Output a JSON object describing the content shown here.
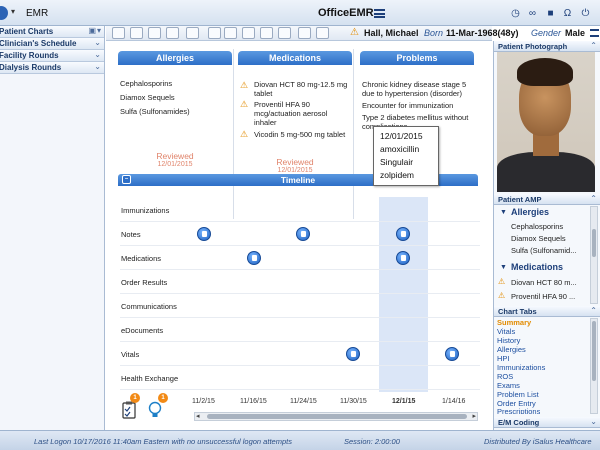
{
  "topbar": {
    "app_name": "EMR",
    "product_title": "OfficeEMR"
  },
  "sidebar": {
    "items": [
      {
        "label": "Patient Charts"
      },
      {
        "label": "Clinician's Schedule"
      },
      {
        "label": "Facility Rounds"
      },
      {
        "label": "Dialysis Rounds"
      }
    ]
  },
  "patient": {
    "name": "Hall, Michael",
    "born_label": "Born",
    "dob": "11-Mar-1968(48y)",
    "gender_label": "Gender",
    "gender": "Male"
  },
  "allergies": {
    "title": "Allergies",
    "items": [
      "Cephalosporins",
      "Diamox Sequels",
      "Sulfa (Sulfonamides)"
    ],
    "reviewed": "Reviewed",
    "reviewed_date": "12/01/2015"
  },
  "medications": {
    "title": "Medications",
    "items": [
      "Diovan HCT 80 mg-12.5 mg tablet",
      "Proventil HFA 90 mcg/actuation aerosol inhaler",
      "Vicodin 5 mg-500 mg tablet"
    ],
    "reviewed": "Reviewed",
    "reviewed_date": "12/01/2015"
  },
  "problems": {
    "title": "Problems",
    "items": [
      "Chronic kidney disease stage 5 due to hypertension (disorder)",
      "Encounter for immunization",
      "Type 2 diabetes mellitus without complications"
    ]
  },
  "popup": {
    "lines": [
      "12/01/2015",
      "amoxicillin",
      "Singulair",
      "zolpidem"
    ]
  },
  "timeline": {
    "title": "Timeline",
    "rows": [
      "Immunizations",
      "Notes",
      "Medications",
      "Order Results",
      "Communications",
      "eDocuments",
      "Vitals",
      "Health Exchange"
    ],
    "dates": [
      "11/2/15",
      "11/16/15",
      "11/24/15",
      "11/30/15",
      "12/1/15",
      "1/14/16"
    ],
    "badge_tasks": "1",
    "badge_alerts": "1"
  },
  "rightpanel": {
    "photo_header": "Patient Photograph",
    "amp_header": "Patient AMP",
    "allergies_title": "Allergies",
    "allergy_items": [
      "Cephalosporins",
      "Diamox Sequels",
      "Sulfa (Sulfonamid..."
    ],
    "medications_title": "Medications",
    "medication_items": [
      "Diovan HCT 80 m...",
      "Proventil HFA 90 ..."
    ],
    "chart_tabs_header": "Chart Tabs",
    "chart_tabs": [
      "Summary",
      "Vitals",
      "History",
      "Allergies",
      "HPI",
      "Immunizations",
      "ROS",
      "Exams",
      "Problem List",
      "Order Entry",
      "Prescriptions"
    ],
    "em_coding_header": "E/M Coding"
  },
  "statusbar": {
    "last_logon": "Last Logon 10/17/2016 11:40am Eastern  with no unsuccessful logon attempts",
    "session": "Session: 2:00:00",
    "distributed": "Distributed By iSalus Healthcare"
  },
  "colors": {
    "accent": "#2d6ec7",
    "warning": "#e28b00",
    "reviewed": "#e0846b",
    "active_tab": "#e28b00"
  }
}
